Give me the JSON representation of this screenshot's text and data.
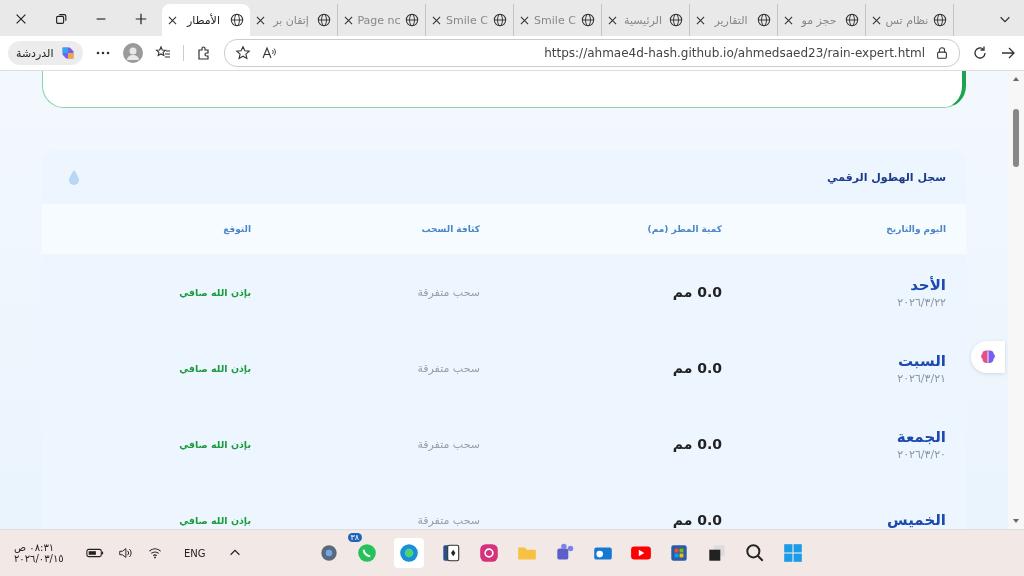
{
  "browser": {
    "tabs": [
      {
        "title": "نظام تس",
        "selected": false
      },
      {
        "title": "حجز مو",
        "selected": false
      },
      {
        "title": "التقارير",
        "selected": false
      },
      {
        "title": "الرئيسية",
        "selected": false
      },
      {
        "title": "Smile C",
        "selected": false
      },
      {
        "title": "Smile C",
        "selected": false
      },
      {
        "title": "Page nc",
        "selected": false
      },
      {
        "title": "إتقان بر",
        "selected": false
      },
      {
        "title": "الأمطار",
        "selected": true
      }
    ],
    "url": "https://ahmae4d-hash.github.io/ahmedsaed23/rain-expert.html",
    "copilot_label": "الدردشة"
  },
  "log": {
    "title": "سجل الهطول الرقمي",
    "columns": [
      "اليوم والتاريخ",
      "كمية المطر (مم)",
      "كثافة السحب",
      "التوقع"
    ],
    "rows": [
      {
        "day": "الأحد",
        "date": "٢٠٢٦/٣/٢٢",
        "rain": "0.0 مم",
        "clouds": "سحب متفرقة",
        "forecast": "بإذن الله صافي"
      },
      {
        "day": "السبت",
        "date": "٢٠٢٦/٣/٢١",
        "rain": "0.0 مم",
        "clouds": "سحب متفرقة",
        "forecast": "بإذن الله صافي"
      },
      {
        "day": "الجمعة",
        "date": "٢٠٢٦/٣/٢٠",
        "rain": "0.0 مم",
        "clouds": "سحب متفرقة",
        "forecast": "بإذن الله صافي"
      },
      {
        "day": "الخميس",
        "rain": "0.0 مم",
        "clouds": "سحب متفرقة",
        "forecast": "بإذن الله صافي"
      }
    ]
  },
  "taskbar": {
    "time": "٠٨:٣١ ص",
    "date": "٢٠٢٦/٠٣/١٥",
    "language": "ENG",
    "whatsapp_badge": "٣٨"
  }
}
